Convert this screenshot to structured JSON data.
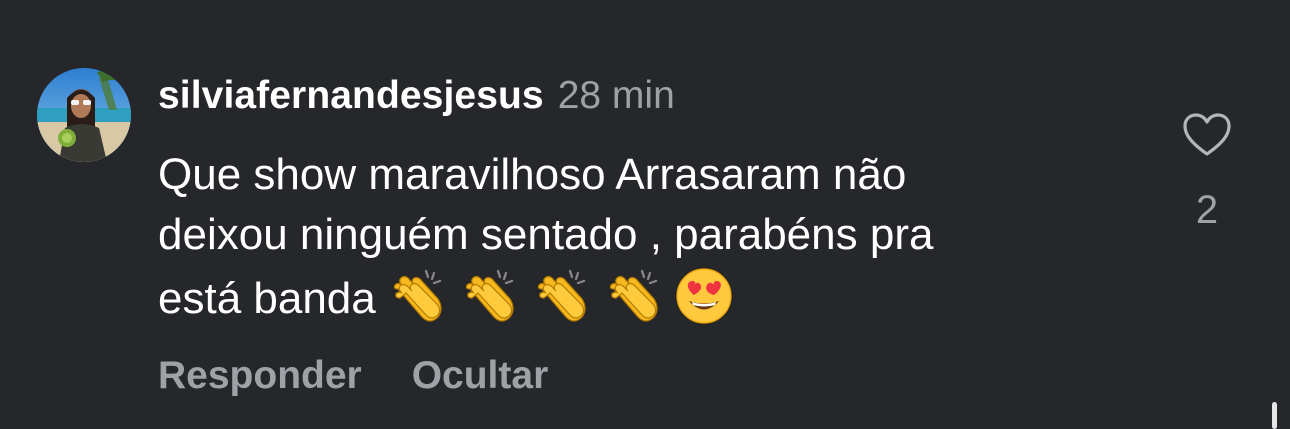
{
  "comment": {
    "username": "silviafernandesjesus",
    "time": "28 min",
    "text_lines": [
      "Que show maravilhoso Arrasaram não",
      "deixou ninguém sentado , parabéns pra",
      "está banda"
    ],
    "emojis": [
      "clapping-hands",
      "clapping-hands",
      "clapping-hands",
      "clapping-hands",
      "heart-eyes"
    ],
    "like_count": "2"
  },
  "actions": {
    "reply": "Responder",
    "hide": "Ocultar"
  },
  "colors": {
    "background": "#25272b",
    "primary_text": "#ffffff",
    "secondary_text": "#9ea1a6"
  }
}
